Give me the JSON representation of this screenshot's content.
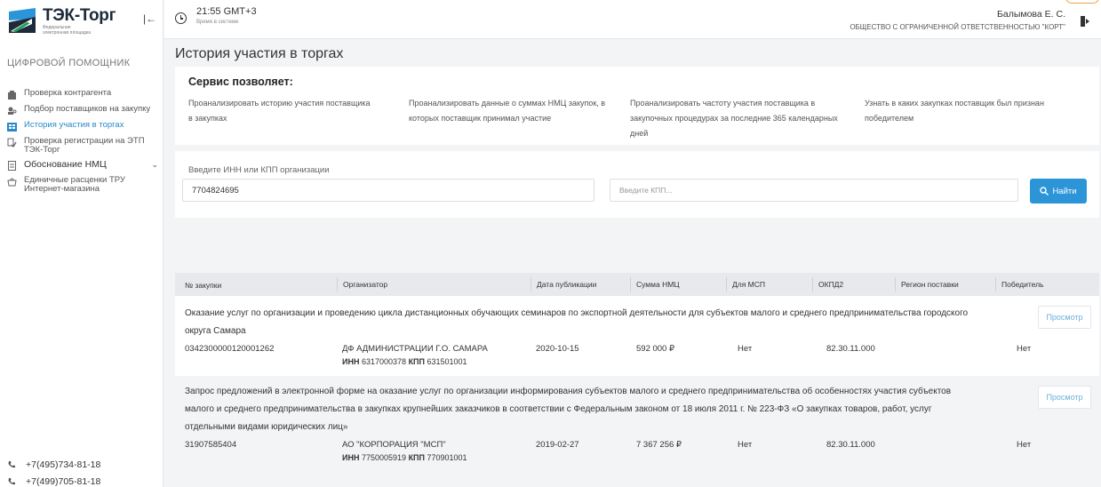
{
  "sidebar": {
    "logo_name": "ТЭК-Торг",
    "logo_sub": "Федеральная электронная площадка",
    "section_title": "ЦИФРОВОЙ ПОМОЩНИК",
    "items": [
      {
        "label": "Проверка контрагента"
      },
      {
        "label": "Подбор поставщиков на закупку"
      },
      {
        "label": "История участия в торгах"
      },
      {
        "label": "Проверка регистрации на ЭТП ТЭК-Торг"
      },
      {
        "label": "Обоснование НМЦ"
      },
      {
        "label": "Единичные расценки ТРУ Интернет-магазина"
      }
    ],
    "phones": [
      "+7(495)734-81-18",
      "+7(499)705-81-18"
    ]
  },
  "topbar": {
    "time": "21:55 GMT+3",
    "time_sub": "Время в системе",
    "user_name": "Балымова Е. С.",
    "user_org": "ОБЩЕСТВО С ОГРАНИЧЕННОЙ ОТВЕТСТВЕННОСТЬЮ \"КОРТ\""
  },
  "page": {
    "title": "История участия в торгах"
  },
  "features": {
    "title": "Сервис позволяет:",
    "items": [
      "Проанализировать историю участия поставщика в закупках",
      "Проанализировать данные о суммах НМЦ закупок, в которых поставщик принимал участие",
      "Проанализировать частоту участия поставщика в закупочных процедурах за последние 365 календарных дней",
      "Узнать в каких закупках поставщик был признан победителем"
    ]
  },
  "search": {
    "label": "Введите ИНН или КПП организации",
    "inn_value": "7704824695",
    "kpp_placeholder": "Введите КПП...",
    "find_label": "Найти"
  },
  "table": {
    "headers": {
      "number": "№ закупки",
      "organizer": "Организатор",
      "date": "Дата публикации",
      "sum": "Сумма НМЦ",
      "msp": "Для МСП",
      "okpd": "ОКПД2",
      "region": "Регион поставки",
      "winner": "Победитель"
    },
    "view_label": "Просмотр",
    "inn_label": "ИНН",
    "kpp_label": "КПП",
    "rows": [
      {
        "title": "Оказание услуг по организации и проведению цикла дистанционных обучающих семинаров по экспортной деятельности для субъектов малого и среднего предпринимательства городского округа Самара",
        "number": "0342300000120001262",
        "organizer": "ДФ АДМИНИСТРАЦИИ Г.О. САМАРА",
        "inn": "6317000378",
        "kpp": "631501001",
        "date": "2020-10-15",
        "sum": "592 000 ₽",
        "msp": "Нет",
        "okpd": "82.30.11.000",
        "winner": "Нет"
      },
      {
        "title": "Запрос предложений в электронной форме на оказание услуг по организации информирования субъектов малого и среднего предпринимательства об особенностях участия субъектов малого и среднего предпринимательства в закупках крупнейших заказчиков в соответствии с Федеральным законом от 18 июля 2011 г. № 223-ФЗ «О закупках товаров, работ, услуг отдельными видами юридических лиц»",
        "number": "31907585404",
        "organizer": "АО \"КОРПОРАЦИЯ \"МСП\"",
        "inn": "7750005919",
        "kpp": "770901001",
        "date": "2019-02-27",
        "sum": "7 367 256 ₽",
        "msp": "Нет",
        "okpd": "82.30.11.000",
        "winner": "Нет"
      }
    ]
  },
  "colors": {
    "accent": "#2c95d8",
    "active_nav": "#2a88c9",
    "logo_dark": "#1d2a3a",
    "logo_green": "#1f9d55",
    "logo_blue": "#2c95d8"
  }
}
